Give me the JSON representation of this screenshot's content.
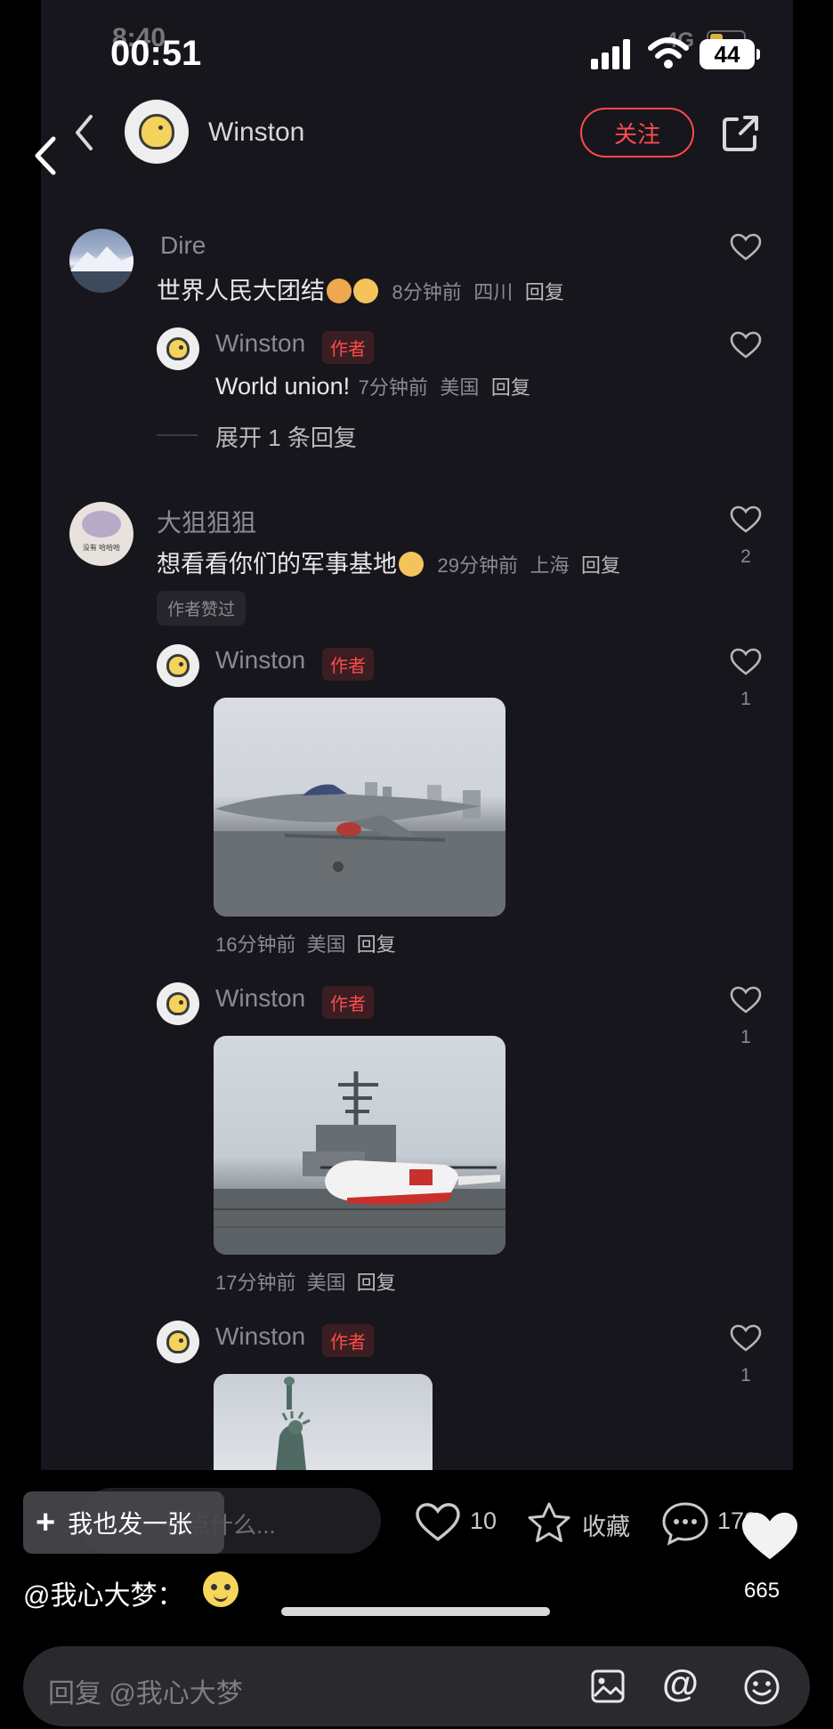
{
  "status_inner": {
    "time": "8:40",
    "network": "4G"
  },
  "status_outer": {
    "time": "00:51",
    "battery": "44"
  },
  "header": {
    "username": "Winston",
    "follow_label": "关注"
  },
  "comments": [
    {
      "user": "Dire",
      "text": "世界人民大团结",
      "time": "8分钟前",
      "location": "四川",
      "reply_label": "回复",
      "replies": [
        {
          "user": "Winston",
          "badge": "作者",
          "text": "World union!",
          "time": "7分钟前",
          "location": "美国",
          "reply_label": "回复"
        }
      ],
      "expand_label": "展开 1 条回复"
    },
    {
      "user": "大狙狙狙",
      "text": "想看看你们的军事基地",
      "time": "29分钟前",
      "location": "上海",
      "reply_label": "回复",
      "likes": "2",
      "liked_by_author": "作者赞过",
      "avatar_caption": "没有 哈哈哈",
      "replies": [
        {
          "user": "Winston",
          "badge": "作者",
          "time": "16分钟前",
          "location": "美国",
          "reply_label": "回复",
          "likes": "1",
          "image": "fighter-jet-on-deck"
        },
        {
          "user": "Winston",
          "badge": "作者",
          "time": "17分钟前",
          "location": "美国",
          "reply_label": "回复",
          "likes": "1",
          "image": "helicopter-and-carrier-island"
        },
        {
          "user": "Winston",
          "badge": "作者",
          "likes": "1",
          "image": "statue-of-liberty"
        }
      ]
    }
  ],
  "inner_bottom_bar": {
    "input_placeholder": "说点什么...",
    "likes": "10",
    "favorite_label": "收藏",
    "comments": "172"
  },
  "overlay_button_label": "我也发一张",
  "outer_likes": "665",
  "mention_text": "@我心大梦：",
  "reply_input_placeholder": "回复 @我心大梦",
  "colors": {
    "accent": "#ff4b4b",
    "panel": "#17161d",
    "background": "#000000"
  }
}
